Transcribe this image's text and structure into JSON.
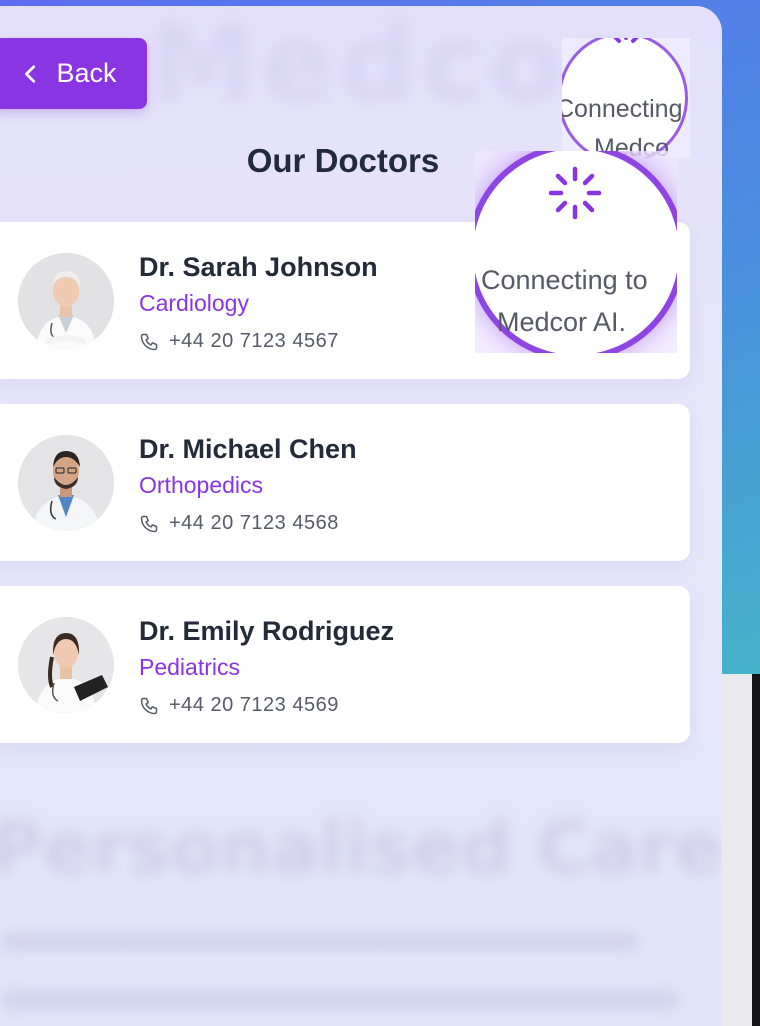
{
  "header": {
    "back_label": "Back",
    "title": "Our Doctors"
  },
  "doctors": [
    {
      "name": "Dr. Sarah Johnson",
      "specialty": "Cardiology",
      "phone": "+44 20 7123 4567"
    },
    {
      "name": "Dr. Michael Chen",
      "specialty": "Orthopedics",
      "phone": "+44 20 7123 4568"
    },
    {
      "name": "Dr. Emily Rodriguez",
      "specialty": "Pediatrics",
      "phone": "+44 20 7123 4569"
    }
  ],
  "loaders": {
    "small": {
      "line1": "Connecting",
      "line2": "Medco"
    },
    "large": {
      "line1": "Connecting to",
      "line2": "Medcor AI."
    }
  },
  "background": {
    "brand_text": "Medcor",
    "section_heading": "Personalised Care"
  },
  "colors": {
    "accent": "#8a35e4",
    "title": "#222b3c",
    "card_bg": "#ffffff"
  },
  "icons": {
    "back": "chevron-left-icon",
    "phone": "phone-icon",
    "spinner": "spinner-icon"
  }
}
